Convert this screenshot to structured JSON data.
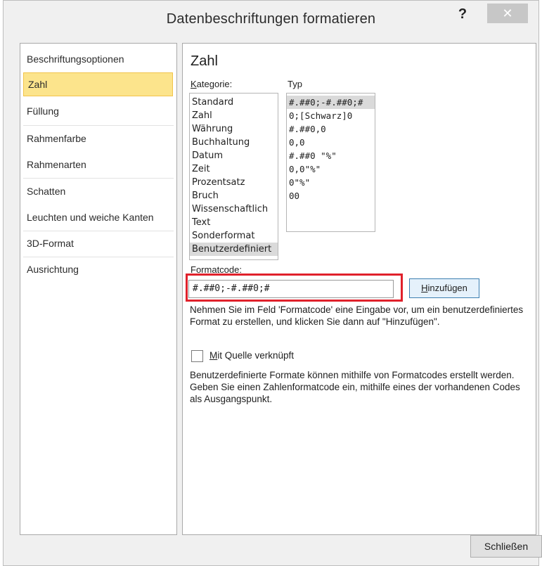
{
  "window": {
    "title": "Datenbeschriftungen formatieren",
    "help_label": "?",
    "close_label": "✕"
  },
  "nav": {
    "items": [
      {
        "label": "Beschriftungsoptionen"
      },
      {
        "label": "Zahl"
      },
      {
        "label": "Füllung"
      },
      {
        "label": "Rahmenfarbe"
      },
      {
        "label": "Rahmenarten"
      },
      {
        "label": "Schatten"
      },
      {
        "label": "Leuchten und weiche Kanten"
      },
      {
        "label": "3D-Format"
      },
      {
        "label": "Ausrichtung"
      }
    ],
    "selected": "Zahl"
  },
  "content": {
    "title": "Zahl",
    "kategorie_label": "Kategorie:",
    "kategorie_accesskey": "K",
    "kategorie_rest": "ategorie:",
    "typ_label": "Typ",
    "kategorie": [
      "Standard",
      "Zahl",
      "Währung",
      "Buchhaltung",
      "Datum",
      "Zeit",
      "Prozentsatz",
      "Bruch",
      "Wissenschaftlich",
      "Text",
      "Sonderformat",
      "Benutzerdefiniert"
    ],
    "kategorie_selected": "Benutzerdefiniert",
    "typ": [
      "#.##0;-#.##0;#",
      "0;[Schwarz]0",
      "#.##0,0",
      "0,0",
      "#.##0 \"%\"",
      "0,0\"%\"",
      "0\"%\"",
      "00"
    ],
    "typ_selected": "#.##0;-#.##0;#",
    "formatcode_label": "Formatcode:",
    "formatcode_accesskey": "F",
    "formatcode_rest": "ormatcode:",
    "formatcode_value": "#.##0;-#.##0;#",
    "add_button_label": "Hinzufügen",
    "add_button_accesskey": "H",
    "add_button_rest": "inzufügen",
    "hint_text": "Nehmen Sie im Feld 'Formatcode' eine Eingabe vor, um ein benutzerdefiniertes Format zu erstellen, und klicken Sie dann auf \"Hinzufügen\".",
    "checkbox_label": "Mit Quelle verknüpft",
    "checkbox_accesskey": "M",
    "checkbox_rest": "it Quelle verknüpft",
    "checkbox_checked": false,
    "info_text": "Benutzerdefinierte Formate können mithilfe von Formatcodes erstellt werden. Geben Sie einen Zahlenformatcode ein, mithilfe eines der vorhandenen Codes als Ausgangspunkt."
  },
  "footer": {
    "close_button_label": "Schließen"
  },
  "colors": {
    "highlight_frame": "#e0212b",
    "selected_nav": "#fce48c",
    "add_button_border": "#3c7fb1"
  }
}
